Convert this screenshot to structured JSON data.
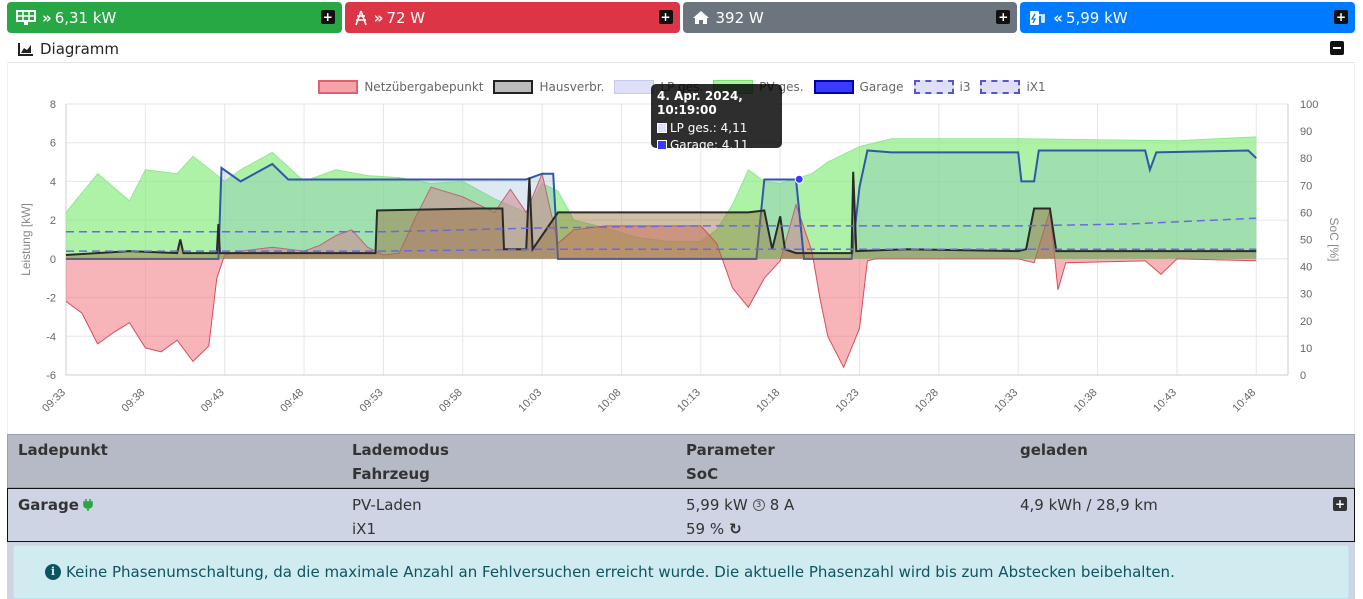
{
  "tiles": [
    {
      "label": "6,31 kW",
      "color": "#28a745",
      "icon": "solar-panel-icon",
      "arrow": "»"
    },
    {
      "label": "72 W",
      "color": "#dc3545",
      "icon": "power-tower-icon",
      "arrow": "»"
    },
    {
      "label": "392 W",
      "color": "#6c757d",
      "icon": "home-icon",
      "arrow": ""
    },
    {
      "label": "5,99 kW",
      "color": "#007bff",
      "icon": "charging-station-icon",
      "arrow": "«"
    }
  ],
  "diagram": {
    "title": "Diagramm"
  },
  "chart_data": {
    "type": "area",
    "legend": [
      {
        "name": "Netzübergabepunkt",
        "color": "#f4a3a8"
      },
      {
        "name": "Hausverbr.",
        "color": "#bbbbbb"
      },
      {
        "name": "LP ges.",
        "color": "#dfe0f7"
      },
      {
        "name": "PV ges.",
        "color": "#a8f3a0"
      },
      {
        "name": "Garage",
        "color": "#3a3aff"
      },
      {
        "name": "i3",
        "color": "#dfe0f7"
      },
      {
        "name": "iX1",
        "color": "#dfe0f7"
      }
    ],
    "y_left_label": "Leistung [kW]",
    "y_right_label": "SoC [%]",
    "y_left_ticks": [
      "8",
      "6",
      "4",
      "2",
      "0",
      "-2",
      "-4",
      "-6"
    ],
    "y_right_ticks": [
      "100",
      "90",
      "80",
      "70",
      "60",
      "50",
      "40",
      "30",
      "20",
      "10",
      "0"
    ],
    "x_ticks": [
      "09:33",
      "09:38",
      "09:43",
      "09:48",
      "09:53",
      "09:58",
      "10:03",
      "10:08",
      "10:13",
      "10:18",
      "10:23",
      "10:28",
      "10:33",
      "10:38",
      "10:43",
      "10:48"
    ],
    "ylim_left": [
      -6,
      8
    ],
    "ylim_right": [
      0,
      100
    ],
    "x_minutes": [
      0,
      5,
      10,
      15,
      20,
      25,
      30,
      35,
      40,
      45,
      50,
      55,
      60,
      65,
      70,
      75
    ],
    "series": [
      {
        "name": "PV ges.",
        "points": [
          [
            0,
            2.4
          ],
          [
            2,
            4.4
          ],
          [
            4,
            3.0
          ],
          [
            5,
            4.6
          ],
          [
            7,
            4.4
          ],
          [
            8,
            5.3
          ],
          [
            10,
            4.0
          ],
          [
            11,
            4.6
          ],
          [
            13,
            5.5
          ],
          [
            15,
            4.0
          ],
          [
            17,
            4.6
          ],
          [
            19,
            4.3
          ],
          [
            21,
            4.2
          ],
          [
            23,
            3.9
          ],
          [
            25,
            4.0
          ],
          [
            27,
            3.1
          ],
          [
            29,
            2.4
          ],
          [
            30,
            3.9
          ],
          [
            31,
            3.5
          ],
          [
            32,
            2.0
          ],
          [
            34,
            1.6
          ],
          [
            36,
            1.1
          ],
          [
            38,
            0.9
          ],
          [
            40,
            0.9
          ],
          [
            41,
            1.5
          ],
          [
            42,
            2.8
          ],
          [
            43,
            4.6
          ],
          [
            44,
            4.0
          ],
          [
            45,
            3.9
          ],
          [
            47,
            4.4
          ],
          [
            48,
            5.0
          ],
          [
            50,
            5.8
          ],
          [
            52,
            6.2
          ],
          [
            60,
            6.2
          ],
          [
            70,
            6.1
          ],
          [
            75,
            6.3
          ]
        ]
      },
      {
        "name": "Netzübergabepunkt",
        "points": [
          [
            0,
            -2.2
          ],
          [
            1,
            -2.8
          ],
          [
            2,
            -4.4
          ],
          [
            3,
            -3.8
          ],
          [
            4,
            -3.3
          ],
          [
            5,
            -4.6
          ],
          [
            6,
            -4.8
          ],
          [
            7,
            -4.2
          ],
          [
            8,
            -5.3
          ],
          [
            9,
            -4.5
          ],
          [
            9.5,
            -1.0
          ],
          [
            10,
            0.2
          ],
          [
            11,
            0.4
          ],
          [
            13,
            0.6
          ],
          [
            15,
            0.4
          ],
          [
            16,
            0.7
          ],
          [
            17,
            1.2
          ],
          [
            18,
            1.5
          ],
          [
            19,
            0.6
          ],
          [
            20,
            0.2
          ],
          [
            21,
            0.3
          ],
          [
            22,
            2.1
          ],
          [
            23,
            3.7
          ],
          [
            25,
            3.2
          ],
          [
            27,
            2.4
          ],
          [
            28,
            3.6
          ],
          [
            29,
            2.4
          ],
          [
            30,
            4.4
          ],
          [
            31,
            0.8
          ],
          [
            32,
            1.5
          ],
          [
            34,
            1.7
          ],
          [
            36,
            1.7
          ],
          [
            38,
            1.7
          ],
          [
            40,
            1.7
          ],
          [
            41,
            0.8
          ],
          [
            42,
            -1.5
          ],
          [
            43,
            -2.5
          ],
          [
            44,
            -1.0
          ],
          [
            45,
            -0.1
          ],
          [
            46,
            2.8
          ],
          [
            47,
            0.4
          ],
          [
            47.5,
            -2.0
          ],
          [
            48,
            -4.0
          ],
          [
            49,
            -5.6
          ],
          [
            50,
            -3.6
          ],
          [
            50.5,
            -0.1
          ],
          [
            51,
            0.0
          ],
          [
            60,
            0.0
          ],
          [
            61,
            -0.2
          ],
          [
            62,
            2.5
          ],
          [
            62.5,
            -1.6
          ],
          [
            63,
            -0.2
          ],
          [
            68,
            -0.1
          ],
          [
            69,
            -0.8
          ],
          [
            70,
            0.0
          ],
          [
            75,
            -0.1
          ]
        ]
      },
      {
        "name": "Garage",
        "points": [
          [
            0,
            0.0
          ],
          [
            9.6,
            0.0
          ],
          [
            9.8,
            4.7
          ],
          [
            11,
            4.0
          ],
          [
            13,
            4.9
          ],
          [
            14,
            4.1
          ],
          [
            21,
            4.1
          ],
          [
            25,
            4.1
          ],
          [
            28,
            4.1
          ],
          [
            29,
            4.1
          ],
          [
            30,
            4.4
          ],
          [
            30.7,
            4.4
          ],
          [
            31,
            0.0
          ],
          [
            43.5,
            0.0
          ],
          [
            44,
            4.1
          ],
          [
            46,
            4.1
          ],
          [
            46.5,
            0.0
          ],
          [
            49.5,
            0.0
          ],
          [
            50,
            3.7
          ],
          [
            50.5,
            5.6
          ],
          [
            52,
            5.5
          ],
          [
            60,
            5.5
          ],
          [
            60.2,
            4.0
          ],
          [
            61,
            4.0
          ],
          [
            61.3,
            5.6
          ],
          [
            68,
            5.6
          ],
          [
            68.3,
            4.6
          ],
          [
            68.7,
            5.5
          ],
          [
            74.5,
            5.6
          ],
          [
            75,
            5.2
          ]
        ]
      },
      {
        "name": "Hausverbr.",
        "points": [
          [
            0,
            0.2
          ],
          [
            4,
            0.4
          ],
          [
            7,
            0.3
          ],
          [
            7.2,
            1.0
          ],
          [
            7.4,
            0.3
          ],
          [
            9.5,
            0.3
          ],
          [
            9.6,
            1.8
          ],
          [
            9.7,
            0.3
          ],
          [
            19.5,
            0.3
          ],
          [
            19.6,
            2.5
          ],
          [
            26,
            2.6
          ],
          [
            27.5,
            2.6
          ],
          [
            27.6,
            0.5
          ],
          [
            29,
            0.5
          ],
          [
            29.2,
            4.2
          ],
          [
            29.4,
            0.5
          ],
          [
            31,
            2.4
          ],
          [
            43,
            2.4
          ],
          [
            44,
            2.5
          ],
          [
            44.5,
            0.5
          ],
          [
            45,
            2.2
          ],
          [
            45.3,
            0.5
          ],
          [
            46,
            0.3
          ],
          [
            49.5,
            0.3
          ],
          [
            49.6,
            4.5
          ],
          [
            49.8,
            0.4
          ],
          [
            53,
            0.5
          ],
          [
            60,
            0.4
          ],
          [
            60.5,
            0.5
          ],
          [
            61,
            2.6
          ],
          [
            62,
            2.6
          ],
          [
            62.4,
            0.4
          ],
          [
            66,
            0.4
          ],
          [
            75,
            0.4
          ]
        ]
      },
      {
        "name": "i3",
        "points": [
          [
            0,
            1.4
          ],
          [
            20,
            1.4
          ],
          [
            30,
            1.6
          ],
          [
            40,
            1.7
          ],
          [
            50,
            1.7
          ],
          [
            60,
            1.7
          ],
          [
            67,
            1.8
          ],
          [
            75,
            2.1
          ]
        ]
      },
      {
        "name": "iX1",
        "points": [
          [
            0,
            0.4
          ],
          [
            20,
            0.4
          ],
          [
            30,
            0.5
          ],
          [
            40,
            0.5
          ],
          [
            75,
            0.5
          ]
        ]
      }
    ]
  },
  "tooltip": {
    "title": "4. Apr. 2024, 10:19:00",
    "lines": [
      {
        "label": "LP ges.: 4,11",
        "color": "#dfe0f7"
      },
      {
        "label": "Garage: 4,11",
        "color": "#3a3aff"
      }
    ]
  },
  "table": {
    "headers": {
      "col1": "Ladepunkt",
      "col2a": "Lademodus",
      "col2b": "Fahrzeug",
      "col3a": "Parameter",
      "col3b": "SoC",
      "col4": "geladen"
    },
    "row": {
      "name": "Garage",
      "mode": "PV-Laden",
      "vehicle": "iX1",
      "power": "5,99 kW",
      "current": "8 A",
      "soc": "59 %",
      "charged": "4,9 kWh / 28,9 km"
    }
  },
  "alert": {
    "text": "Keine Phasenumschaltung, da die maximale Anzahl an Fehlversuchen erreicht wurde. Die aktuelle Phasenzahl wird bis zum Abstecken beibehalten."
  }
}
